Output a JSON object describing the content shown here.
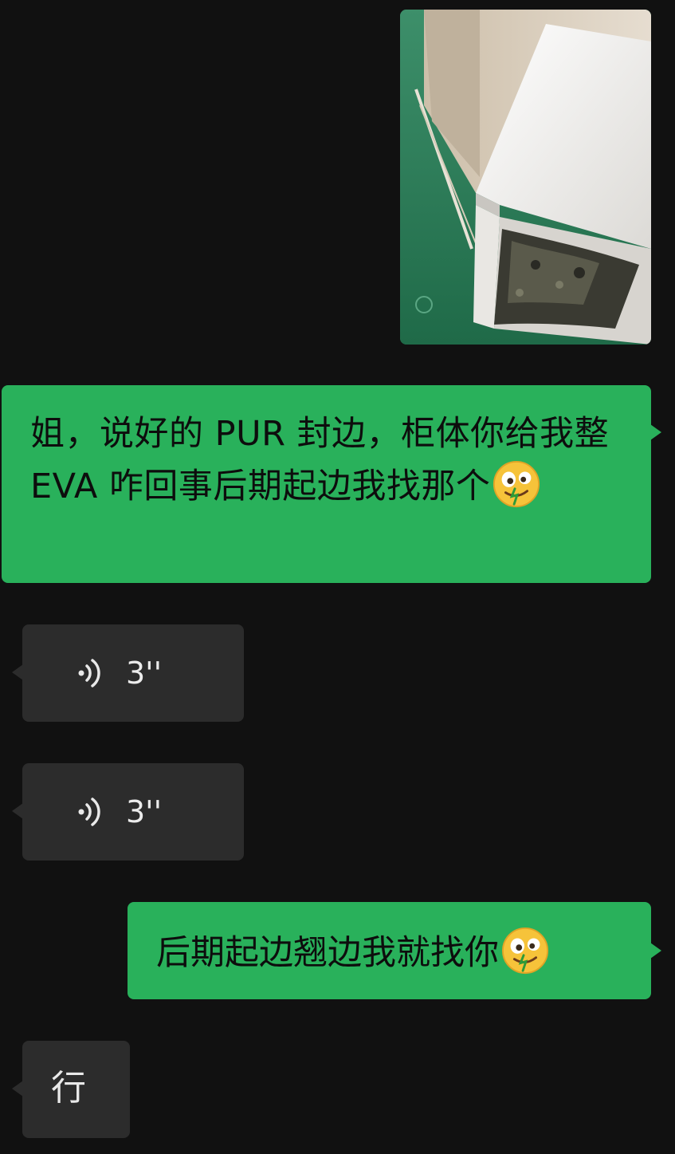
{
  "messages": [
    {
      "type": "image",
      "side": "out"
    },
    {
      "type": "text",
      "side": "out",
      "text": "姐，说好的 PUR 封边，柜体你给我整 EVA 咋回事后期起边我找那个",
      "emoji": "zany-face"
    },
    {
      "type": "voice",
      "side": "in",
      "duration": "3''"
    },
    {
      "type": "voice",
      "side": "in",
      "duration": "3''"
    },
    {
      "type": "text",
      "side": "out",
      "text": "后期起边翘边我就找你",
      "emoji": "zany-face"
    },
    {
      "type": "text",
      "side": "in",
      "text": "行"
    }
  ],
  "colors": {
    "background": "#111111",
    "outgoing_bubble": "#29b15b",
    "incoming_bubble": "#2c2c2c"
  }
}
